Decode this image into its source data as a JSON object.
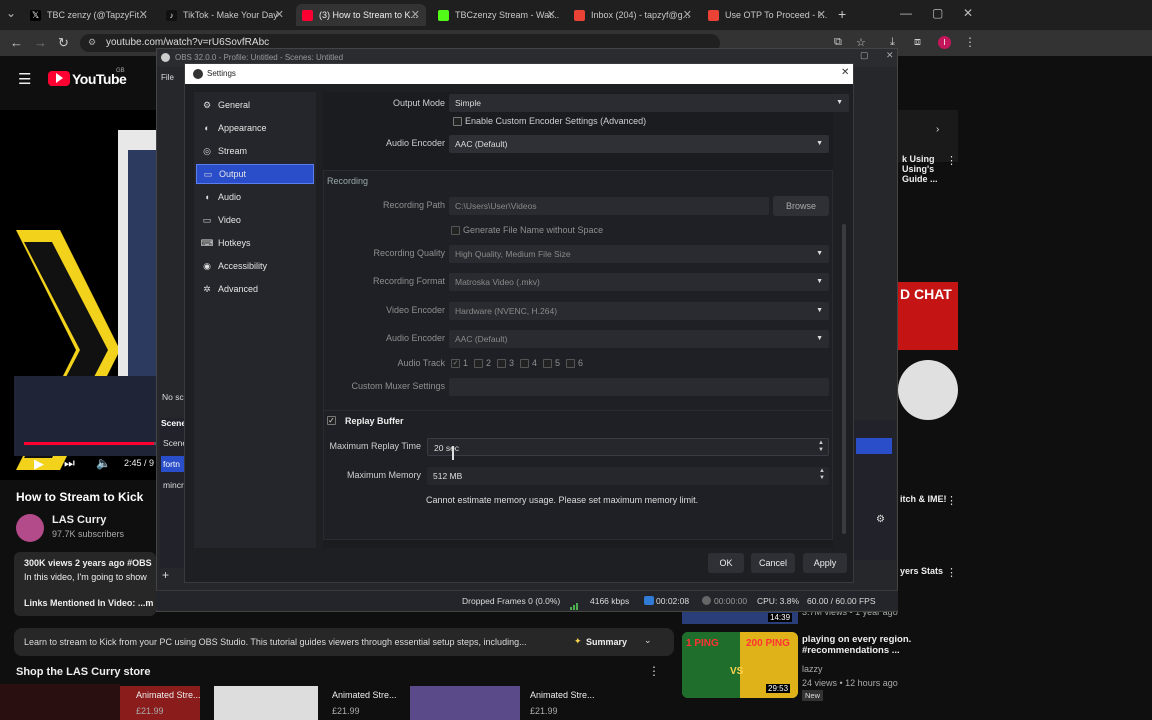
{
  "browser": {
    "tabs": [
      {
        "label": "TBC zenzy (@TapzyFit...",
        "color": "#111111"
      },
      {
        "label": "TikTok - Make Your Day",
        "color": "#111111"
      },
      {
        "label": "(3) How to Stream to K...",
        "color": "#ff0033"
      },
      {
        "label": "TBCzenzy Stream - Wat...",
        "color": "#53fc18"
      },
      {
        "label": "Inbox (204) - tapzyf@g...",
        "color": "#ea4335"
      },
      {
        "label": "Use OTP To Proceed - l...",
        "color": "#ea4335"
      }
    ],
    "new_tab": "+",
    "url": "youtube.com/watch?v=rU6SovfRAbc",
    "window_controls": [
      "—",
      "▢",
      "✕"
    ]
  },
  "youtube": {
    "logo": "YouTube",
    "logo_sup": "GB",
    "video_title": "How to Stream to Kick",
    "channel": "LAS Curry",
    "subscribers": "97.7K subscribers",
    "time": "2:45 / 9",
    "views": "300K views  2 years ago  #OBS",
    "desc_line": "In this video, I'm going to show",
    "links": "Links Mentioned In Video: ...m",
    "desc_full": "Learn to stream to Kick from your PC using OBS Studio. This tutorial guides viewers through essential setup steps, including...",
    "summary": "Summary",
    "shop": "Shop the LAS Curry store",
    "shelf": [
      "Animated Stre...",
      "Animated Stre...",
      "Animated Stre..."
    ],
    "shelf_prices": [
      "£21.99",
      "£21.99",
      "£21.99"
    ],
    "side_titles": [
      "k Using Using's Guide ...",
      "itch & IME!",
      "yers Stats"
    ],
    "side_video_title": "playing on every region. #recommendations ...",
    "side_video_channel": "lazzy",
    "side_video_meta": "24 views • 12 hours ago",
    "side_video_badge": "New",
    "durations": [
      "14:39",
      "29:53"
    ],
    "rec_meta": "3.7M views • 1 year ago",
    "thumb_text": [
      "1 PING",
      "200 PING",
      "VS"
    ],
    "chat_text": "D CHAT"
  },
  "obs": {
    "main_title": "OBS 32.0.0 - Profile: Untitled - Scenes: Untitled",
    "scene_labels": [
      "Scene",
      "Scene",
      "fortn",
      "mincr"
    ],
    "no_sc": "No sc",
    "status": {
      "dropped": "Dropped Frames 0 (0.0%)",
      "kbps": "4166 kbps",
      "stream_time": "00:02:08",
      "rec_time": "00:00:00",
      "cpu": "CPU: 3.8%",
      "fps": "60.00 / 60.00 FPS"
    }
  },
  "settings": {
    "title": "Settings",
    "sidebar": [
      {
        "label": "General",
        "icon": "gear-icon"
      },
      {
        "label": "Appearance",
        "icon": "palette-icon"
      },
      {
        "label": "Stream",
        "icon": "globe-icon"
      },
      {
        "label": "Output",
        "icon": "monitor-icon"
      },
      {
        "label": "Audio",
        "icon": "speaker-icon"
      },
      {
        "label": "Video",
        "icon": "screen-icon"
      },
      {
        "label": "Hotkeys",
        "icon": "keyboard-icon"
      },
      {
        "label": "Accessibility",
        "icon": "accessibility-icon"
      },
      {
        "label": "Advanced",
        "icon": "wrench-icon"
      }
    ],
    "selected": "Output",
    "output_mode_label": "Output Mode",
    "output_mode_value": "Simple",
    "custom_encoder_label": "Enable Custom Encoder Settings (Advanced)",
    "audio_encoder_label": "Audio Encoder",
    "audio_encoder_value": "AAC (Default)",
    "recording_header": "Recording",
    "recording_path_label": "Recording Path",
    "recording_path_value": "C:\\Users\\User\\Videos",
    "browse": "Browse",
    "gen_filename_label": "Generate File Name without Space",
    "rec_quality_label": "Recording Quality",
    "rec_quality_value": "High Quality, Medium File Size",
    "rec_format_label": "Recording Format",
    "rec_format_value": "Matroska Video (.mkv)",
    "video_encoder_label": "Video Encoder",
    "video_encoder_value": "Hardware (NVENC, H.264)",
    "rec_audio_encoder_label": "Audio Encoder",
    "rec_audio_encoder_value": "AAC (Default)",
    "audio_track_label": "Audio Track",
    "audio_tracks": [
      "1",
      "2",
      "3",
      "4",
      "5",
      "6"
    ],
    "muxer_label": "Custom Muxer Settings",
    "muxer_value": "",
    "replay_buffer_label": "Replay Buffer",
    "max_replay_label": "Maximum Replay Time",
    "max_replay_value": "20 sec",
    "max_memory_label": "Maximum Memory",
    "max_memory_value": "512 MB",
    "memory_warning": "Cannot estimate memory usage. Please set maximum memory limit.",
    "ok": "OK",
    "cancel": "Cancel",
    "apply": "Apply"
  }
}
